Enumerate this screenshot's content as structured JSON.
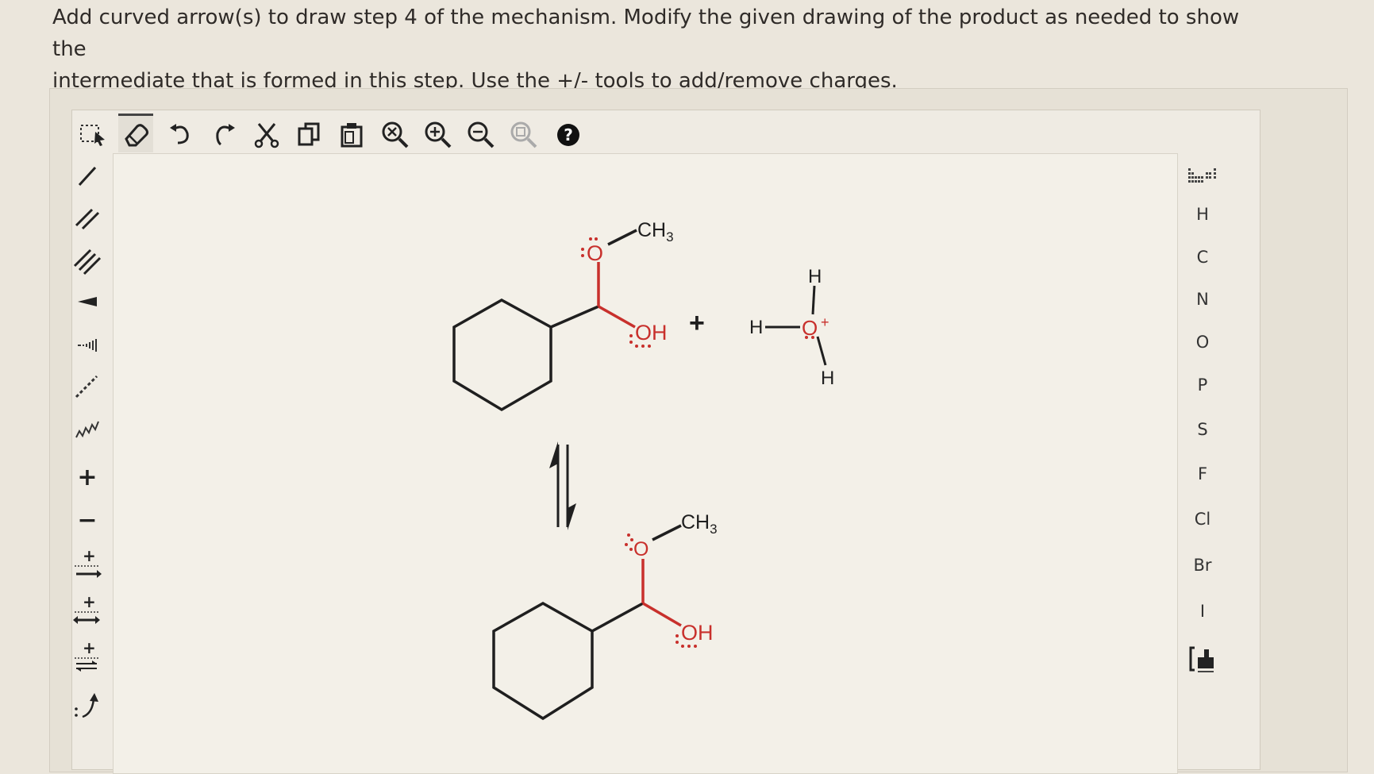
{
  "instructions": {
    "line1": "Add curved arrow(s) to draw step 4 of the mechanism. Modify the given drawing of the product as needed to show the",
    "line2": "intermediate that is formed in this step. Use the +/- tools to add/remove charges."
  },
  "toolbar": {
    "icons": [
      "selection-icon",
      "eraser-icon",
      "undo-icon",
      "redo-icon",
      "cut-icon",
      "copy-icon",
      "paste-icon",
      "clear-icon",
      "zoom-in-icon",
      "zoom-out-icon",
      "zoom-fit-icon",
      "help-icon"
    ],
    "help_label": "?"
  },
  "left_tools": {
    "icons": [
      "single-bond-icon",
      "double-bond-icon",
      "triple-bond-icon",
      "wedge-bond-icon",
      "hash-bond-icon",
      "dashed-bond-icon",
      "wavy-bond-icon",
      "positive-charge-icon",
      "negative-charge-icon",
      "electron-push-icon",
      "resonance-arrow-icon",
      "equilibrium-arrow-icon",
      "curved-arrow-icon"
    ],
    "plus_label": "+",
    "minus_label": "−"
  },
  "elements": [
    "H",
    "C",
    "N",
    "O",
    "P",
    "S",
    "F",
    "Cl",
    "Br",
    "I"
  ],
  "reaction": {
    "top_molecule": {
      "substituent": "CH3",
      "o_label": "O",
      "oh_label": "OH"
    },
    "plus_sign": "+",
    "hydronium": {
      "h_top": "H",
      "h_left": "H",
      "o_label": "O",
      "charge": "+",
      "h_bottom": "H"
    },
    "bottom_molecule": {
      "substituent": "CH3",
      "o_label": "O",
      "oh_label": "OH"
    }
  },
  "colors": {
    "oxygen": "#c8302c",
    "bond": "#1f1f1f",
    "background": "#f3f0e8"
  }
}
